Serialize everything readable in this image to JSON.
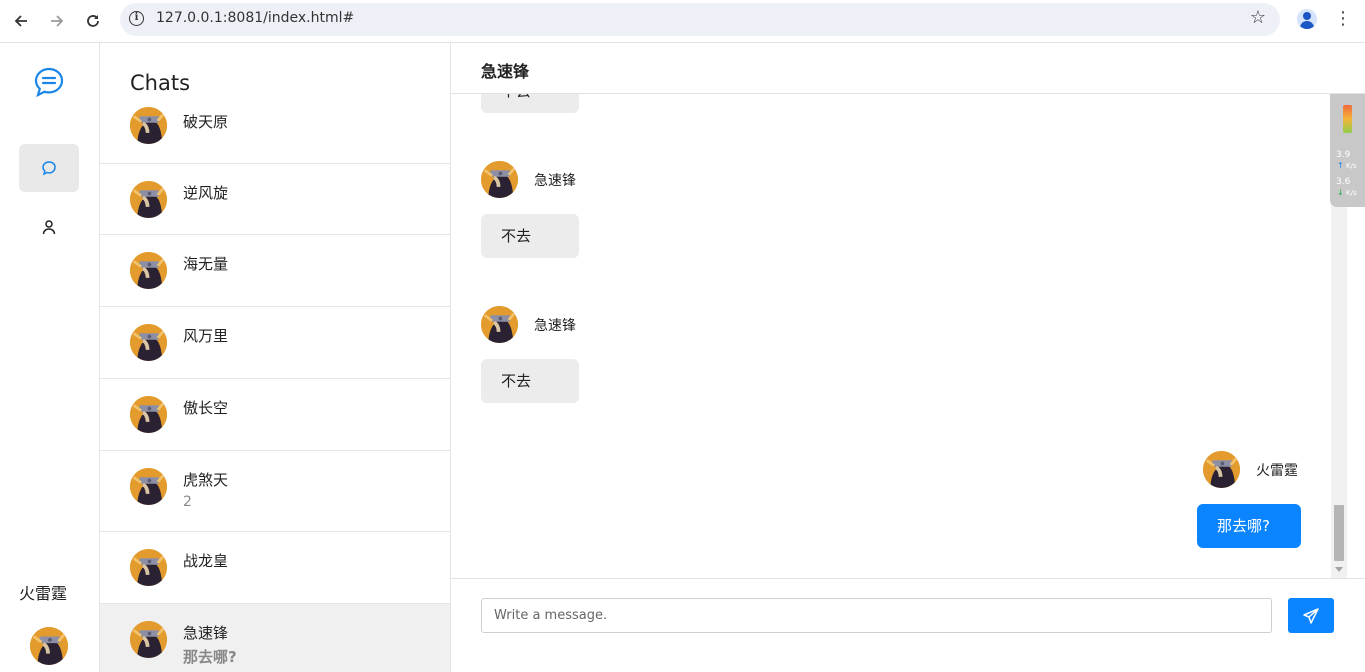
{
  "browser": {
    "url": "127.0.0.1:8081/index.html#"
  },
  "rail": {
    "current_user": "火雷霆"
  },
  "chat_list": {
    "title": "Chats",
    "items": [
      {
        "name": "破天原",
        "sub": ""
      },
      {
        "name": "逆风旋",
        "sub": ""
      },
      {
        "name": "海无量",
        "sub": ""
      },
      {
        "name": "风万里",
        "sub": ""
      },
      {
        "name": "傲长空",
        "sub": ""
      },
      {
        "name": "虎煞天",
        "sub": "2"
      },
      {
        "name": "战龙皇",
        "sub": ""
      },
      {
        "name": "急速锋",
        "sub": "那去哪?"
      }
    ]
  },
  "conversation": {
    "peer": "急速锋",
    "messages": [
      {
        "sender": "急速锋",
        "text": "不去",
        "direction": "in"
      },
      {
        "sender": "急速锋",
        "text": "不去",
        "direction": "in"
      },
      {
        "sender": "急速锋",
        "text": "不去",
        "direction": "in"
      },
      {
        "sender": "火雷霆",
        "text": "那去哪?",
        "direction": "out"
      }
    ],
    "composer_placeholder": "Write a message."
  },
  "net_widget": {
    "upload": "3.9",
    "upload_unit": "K/s",
    "download": "3.6",
    "download_unit": "K/s"
  },
  "colors": {
    "accent": "#0a84ff",
    "incoming_bubble": "#ececec",
    "active_item": "#f0f0f0"
  }
}
